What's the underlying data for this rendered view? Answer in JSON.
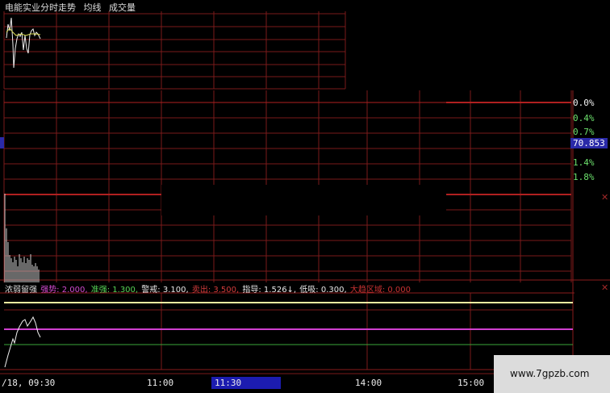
{
  "header": {
    "title": "电能实业分时走势",
    "avg_label": "均线",
    "volume_label": "成交量"
  },
  "right_axis": {
    "pct_labels": [
      "0.0%",
      "0.4%",
      "0.7%",
      "1.4%",
      "1.8%"
    ],
    "price_box": "70.853",
    "pct_color": "#6ce06c",
    "pct_first_color": "#f4f4f4"
  },
  "indicator": {
    "items": [
      {
        "text": "浓弱留强",
        "color": "#dcdcdc"
      },
      {
        "text": "强势: 2.000,",
        "color": "#d24bd2"
      },
      {
        "text": "准强: 1.300,",
        "color": "#56d456"
      },
      {
        "text": "警戒: 3.100,",
        "color": "#e8e8e8"
      },
      {
        "text": "卖出: 3.500,",
        "color": "#d23c3c"
      },
      {
        "text": "指导: 1.526↓,",
        "color": "#e8e8e8"
      },
      {
        "text": "低吸: 0.300,",
        "color": "#e8e8e8"
      },
      {
        "text": "大趋区域: 0.000",
        "color": "#c83232"
      }
    ]
  },
  "time_axis": {
    "labels": [
      "/18, 09:30",
      "11:00",
      "11:30",
      "14:00",
      "15:00"
    ],
    "selected": "11:30"
  },
  "watermark": "www.7gpzb.com",
  "colors": {
    "grid": "#7a1a1a",
    "grid_bright": "#b02020",
    "panel_border": "#8a1c1c",
    "line_yellow": "#f2f0a0",
    "line_magenta": "#d040d0",
    "line_green": "#3aa83a",
    "price_line": "#f0f0f0"
  }
}
